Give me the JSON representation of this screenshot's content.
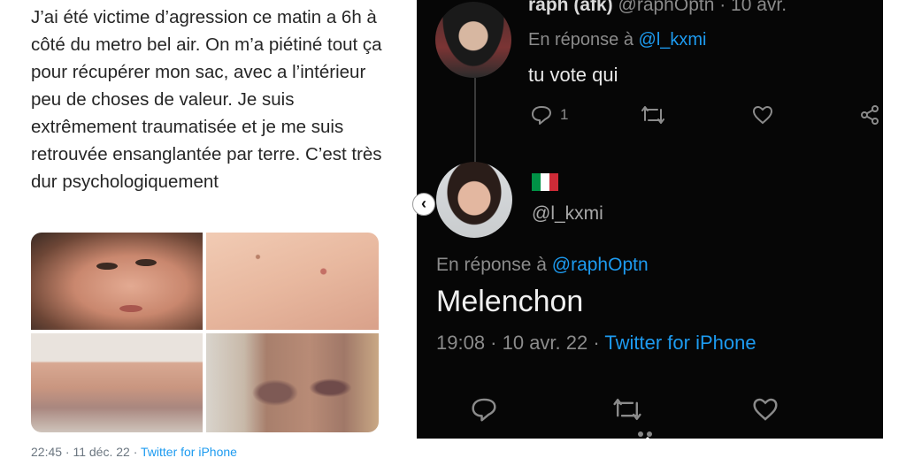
{
  "left_tweet": {
    "text": "J’ai été victime d’agression ce matin a 6h à côté du metro bel air. On m’a piétiné tout ça pour récupérer mon sac, avec a l’intérieur peu de choses de valeur. Je suis extrêmement traumatisée et je me suis retrouvée ensanglantée par terre. C’est très dur psychologiquement",
    "meta_time": "22:45 · 11 déc. 22 · ",
    "meta_source": "Twitter for iPhone"
  },
  "right_thread": {
    "first": {
      "name": "raph (afk) ",
      "handle": "@raphOptn · 10 avr.",
      "reply_prefix": "En réponse à ",
      "reply_to": "@l_kxmi",
      "text": "tu vote qui",
      "reply_count": "1"
    },
    "second": {
      "handle": "@l_kxmi",
      "reply_prefix": "En réponse à ",
      "reply_to": "@raphOptn",
      "text": "Melenchon",
      "meta_time": "19:08 · 10 avr. 22 · ",
      "meta_source": "Twitter for iPhone"
    },
    "nav_prev_glyph": "‹"
  },
  "colors": {
    "twitter_blue": "#1d9bf0",
    "dark_bg": "#060606",
    "flag_green": "#009246",
    "flag_white": "#ffffff",
    "flag_red": "#ce2b37"
  }
}
